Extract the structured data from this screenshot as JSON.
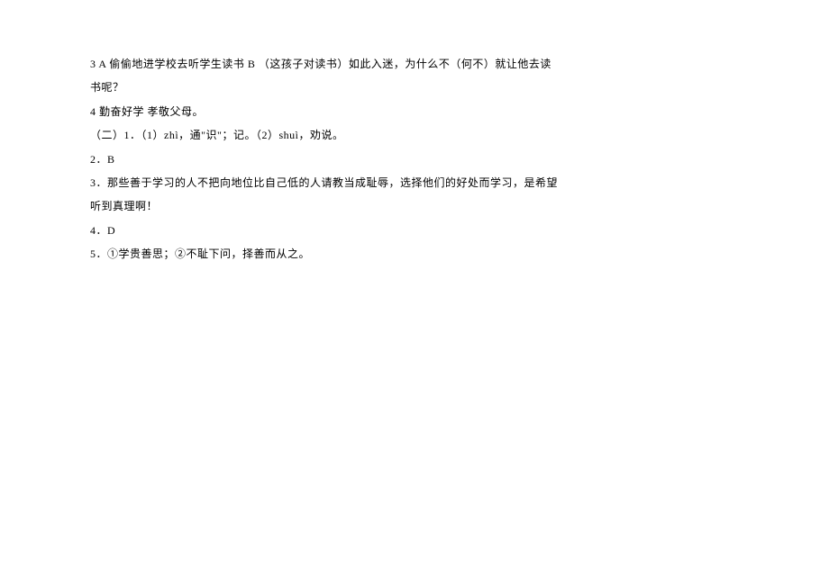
{
  "lines": [
    "3 A 偷偷地进学校去听学生读书 B （这孩子对读书）如此入迷，为什么不（何不）就让他去读",
    "书呢？",
    "4 勤奋好学 孝敬父母。",
    "（二）1．（1）zhì，通\"识\"；记。（2）shuì，劝说。",
    "2．B",
    "3．那些善于学习的人不把向地位比自己低的人请教当成耻辱，选择他们的好处而学习，是希望",
    "听到真理啊！",
    "4．D",
    "5．①学贵善思；②不耻下问，择善而从之。"
  ]
}
